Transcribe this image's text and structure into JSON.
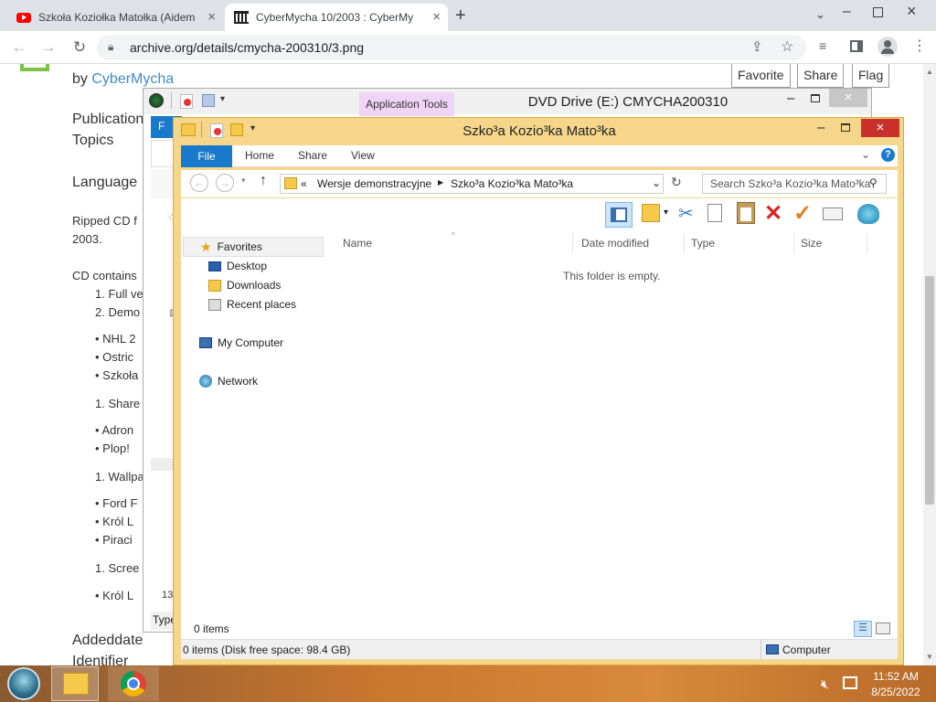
{
  "browser": {
    "tabs": [
      {
        "title": "Szkoła Koziołka Matołka (Aidem"
      },
      {
        "title": "CyberMycha 10/2003 : CyberMy"
      }
    ],
    "url": "archive.org/details/cmycha-200310/3.png"
  },
  "page": {
    "byline_prefix": "by",
    "author": "CyberMycha",
    "buttons": [
      "Favorite",
      "Share",
      "Flag"
    ],
    "labels": [
      "Publication",
      "Topics",
      "Language"
    ],
    "ripped": [
      "Ripped CD f",
      "2003."
    ],
    "cd_contains": "CD contains",
    "list": [
      "1. Full ve",
      "2. Demo",
      "NHL 2",
      "Ostric",
      "Szkoła",
      "1. Share",
      "Adron",
      "Plop!",
      "1. Wallpa",
      "Ford F",
      "Król L",
      "Piraci",
      "1. Scree",
      "Król L"
    ],
    "added": "Addeddate",
    "identifier": "Identifier"
  },
  "bg_window": {
    "title": "DVD Drive (E:) CMYCHA200310",
    "context_tab": "Application Tools",
    "left_fragments": [
      "F",
      "13",
      "Type"
    ]
  },
  "explorer": {
    "title": "Szko³a Kozio³ka Mato³ka",
    "ribbon_tabs": [
      "File",
      "Home",
      "Share",
      "View"
    ],
    "breadcrumb": [
      "«",
      "Wersje demonstracyjne",
      "Szko³a Kozio³ka Mato³ka"
    ],
    "search_placeholder": "Search Szko³a Kozio³ka Mato³ka",
    "nav": {
      "favorites": "Favorites",
      "items": [
        "Desktop",
        "Downloads",
        "Recent places"
      ],
      "computer": "My Computer",
      "network": "Network"
    },
    "columns": [
      "Name",
      "Date modified",
      "Type",
      "Size"
    ],
    "empty_text": "This folder is empty.",
    "status_items": "0 items",
    "status_disk": "0 items (Disk free space: 98.4 GB)",
    "status_location": "Computer"
  },
  "taskbar": {
    "time": "11:52 AM",
    "date": "8/25/2022"
  }
}
